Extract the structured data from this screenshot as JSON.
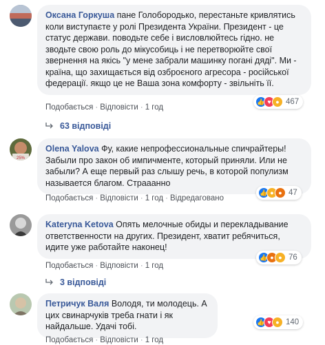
{
  "comments": [
    {
      "author": "Оксана Горкуша",
      "text": "пане Голобородько, перестаньте кривлятись коли виступаєте у ролі Президента України. Президент - це статус держави. поводьте себе і висловлюйтесь гідно. не зводьте свою роль до мікусобиць і не перетворюйте свої звернення на якісь \"у мене забрали машинку погані дяді\". Ми - країна, що захищається від озброєного агресора - російської федерації. якщо це не Ваша зона комфорту - звільніть її.",
      "like": "Подобається",
      "reply": "Відповісти",
      "time": "1 год",
      "reactions": [
        "like",
        "love",
        "wow"
      ],
      "count": "467",
      "replies": "63 відповіді"
    },
    {
      "author": "Olena Yalova",
      "text": "Фу, какие непрофессиональные спичрайтеры! Забыли про закон об импичменте, который приняли. Или не забыли? А еще первый раз слышу речь, в которой популизм называется благом. Страаанно",
      "like": "Подобається",
      "reply": "Відповісти",
      "time": "1 год",
      "edited": "Відредаговано",
      "reactions": [
        "like",
        "haha",
        "angry"
      ],
      "count": "47"
    },
    {
      "author": "Kateryna Ketova",
      "text": "Опять мелочные обиды и перекладывание ответственности на других. Президент, хватит ребячиться, идите уже работайте наконец!",
      "like": "Подобається",
      "reply": "Відповісти",
      "time": "1 год",
      "reactions": [
        "like",
        "angry",
        "sad"
      ],
      "count": "76",
      "replies": "3 відповіді"
    },
    {
      "author": "Петричук Валя",
      "text": "Володя, ти молодець. А цих свинарчуків треба гнати і як найдальше. Удачі тобі.",
      "like": "Подобається",
      "reply": "Відповісти",
      "time": "1 год",
      "reactions": [
        "like",
        "love",
        "haha"
      ],
      "count": "140"
    }
  ],
  "colors": {
    "link": "#385898",
    "bubble": "#f2f3f5",
    "like": "#1877f2",
    "love": "#f33e58",
    "haha": "#f7b125",
    "angry": "#e9710f"
  }
}
